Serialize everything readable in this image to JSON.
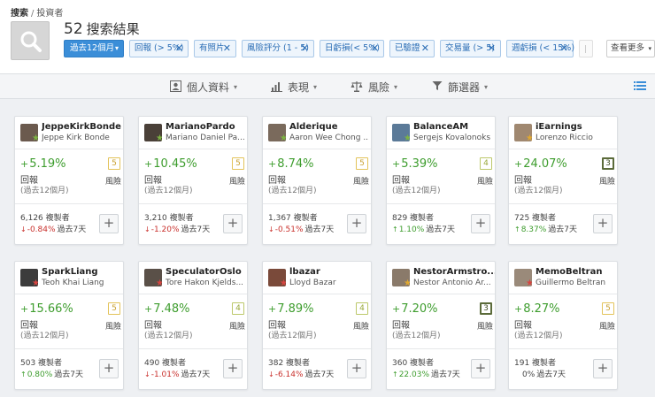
{
  "breadcrumb": {
    "root": "搜索",
    "sep": "/",
    "current": "投資者"
  },
  "results": {
    "count": "52",
    "label": "搜索結果"
  },
  "period_button": {
    "label": "過去12個月",
    "caret": "▾"
  },
  "filters": [
    {
      "label": "回報 (> 5%)",
      "x": "✕"
    },
    {
      "label": "有照片",
      "x": "✕"
    },
    {
      "label": "風險評分 (1 - 5)",
      "x": "✕"
    },
    {
      "label": "日虧損(< 5%)",
      "x": "✕"
    },
    {
      "label": "已驗證",
      "x": "✕"
    },
    {
      "label": "交易量 (> 5)",
      "x": "✕"
    },
    {
      "label": "週虧損 (< 15%)",
      "x": "✕"
    }
  ],
  "view_more": {
    "label": "查看更多",
    "caret": "▾"
  },
  "tabs": [
    {
      "label": "個人資料",
      "icon": "profile-icon"
    },
    {
      "label": "表現",
      "icon": "bar-chart-icon"
    },
    {
      "label": "風險",
      "icon": "scale-icon"
    },
    {
      "label": "篩選器",
      "icon": "filter-icon"
    }
  ],
  "card_labels": {
    "gain": "回報",
    "period": "(過去12個月)",
    "risk": "風險",
    "copiers_suffix": "複製者",
    "change_period": "過去7天",
    "add": "+"
  },
  "colors": {
    "positive": "#3e9d2e",
    "negative": "#c9302c",
    "accent": "#3b8ed8"
  },
  "investors": [
    {
      "username": "JeppeKirkBonde",
      "fullname": "Jeppe Kirk Bonde",
      "gain": "5.19%",
      "risk": "5",
      "copiers": "6,126",
      "change": "-0.84%",
      "dir": "down",
      "star": "green"
    },
    {
      "username": "MarianoPardo",
      "fullname": "Mariano Daniel Pa...",
      "gain": "10.45%",
      "risk": "5",
      "copiers": "3,210",
      "change": "-1.20%",
      "dir": "down",
      "star": "green"
    },
    {
      "username": "Alderique",
      "fullname": "Aaron Wee Chong ...",
      "gain": "8.74%",
      "risk": "5",
      "copiers": "1,367",
      "change": "-0.51%",
      "dir": "down",
      "star": "green"
    },
    {
      "username": "BalanceAM",
      "fullname": "Sergejs Kovalonoks",
      "gain": "5.39%",
      "risk": "4",
      "copiers": "829",
      "change": "1.10%",
      "dir": "up",
      "star": "green"
    },
    {
      "username": "iEarnings",
      "fullname": "Lorenzo Riccio",
      "gain": "24.07%",
      "risk": "3",
      "copiers": "725",
      "change": "8.37%",
      "dir": "up",
      "star": "gold"
    },
    {
      "username": "SparkLiang",
      "fullname": "Teoh Khai Liang",
      "gain": "15.66%",
      "risk": "5",
      "copiers": "503",
      "change": "0.80%",
      "dir": "up",
      "star": "red"
    },
    {
      "username": "SpeculatorOslo",
      "fullname": "Tore Hakon Kjelds...",
      "gain": "7.48%",
      "risk": "4",
      "copiers": "490",
      "change": "-1.01%",
      "dir": "down",
      "star": "red"
    },
    {
      "username": "lbazar",
      "fullname": "Lloyd Bazar",
      "gain": "7.89%",
      "risk": "4",
      "copiers": "382",
      "change": "-6.14%",
      "dir": "down",
      "star": "red"
    },
    {
      "username": "NestorArmstro...",
      "fullname": "Nestor Antonio Ar...",
      "gain": "7.20%",
      "risk": "3",
      "copiers": "360",
      "change": "22.03%",
      "dir": "up",
      "star": "gold"
    },
    {
      "username": "MemoBeltran",
      "fullname": "Guillermo Beltran",
      "gain": "8.27%",
      "risk": "5",
      "copiers": "191",
      "change": "0%",
      "dir": "flat",
      "star": "red"
    }
  ]
}
